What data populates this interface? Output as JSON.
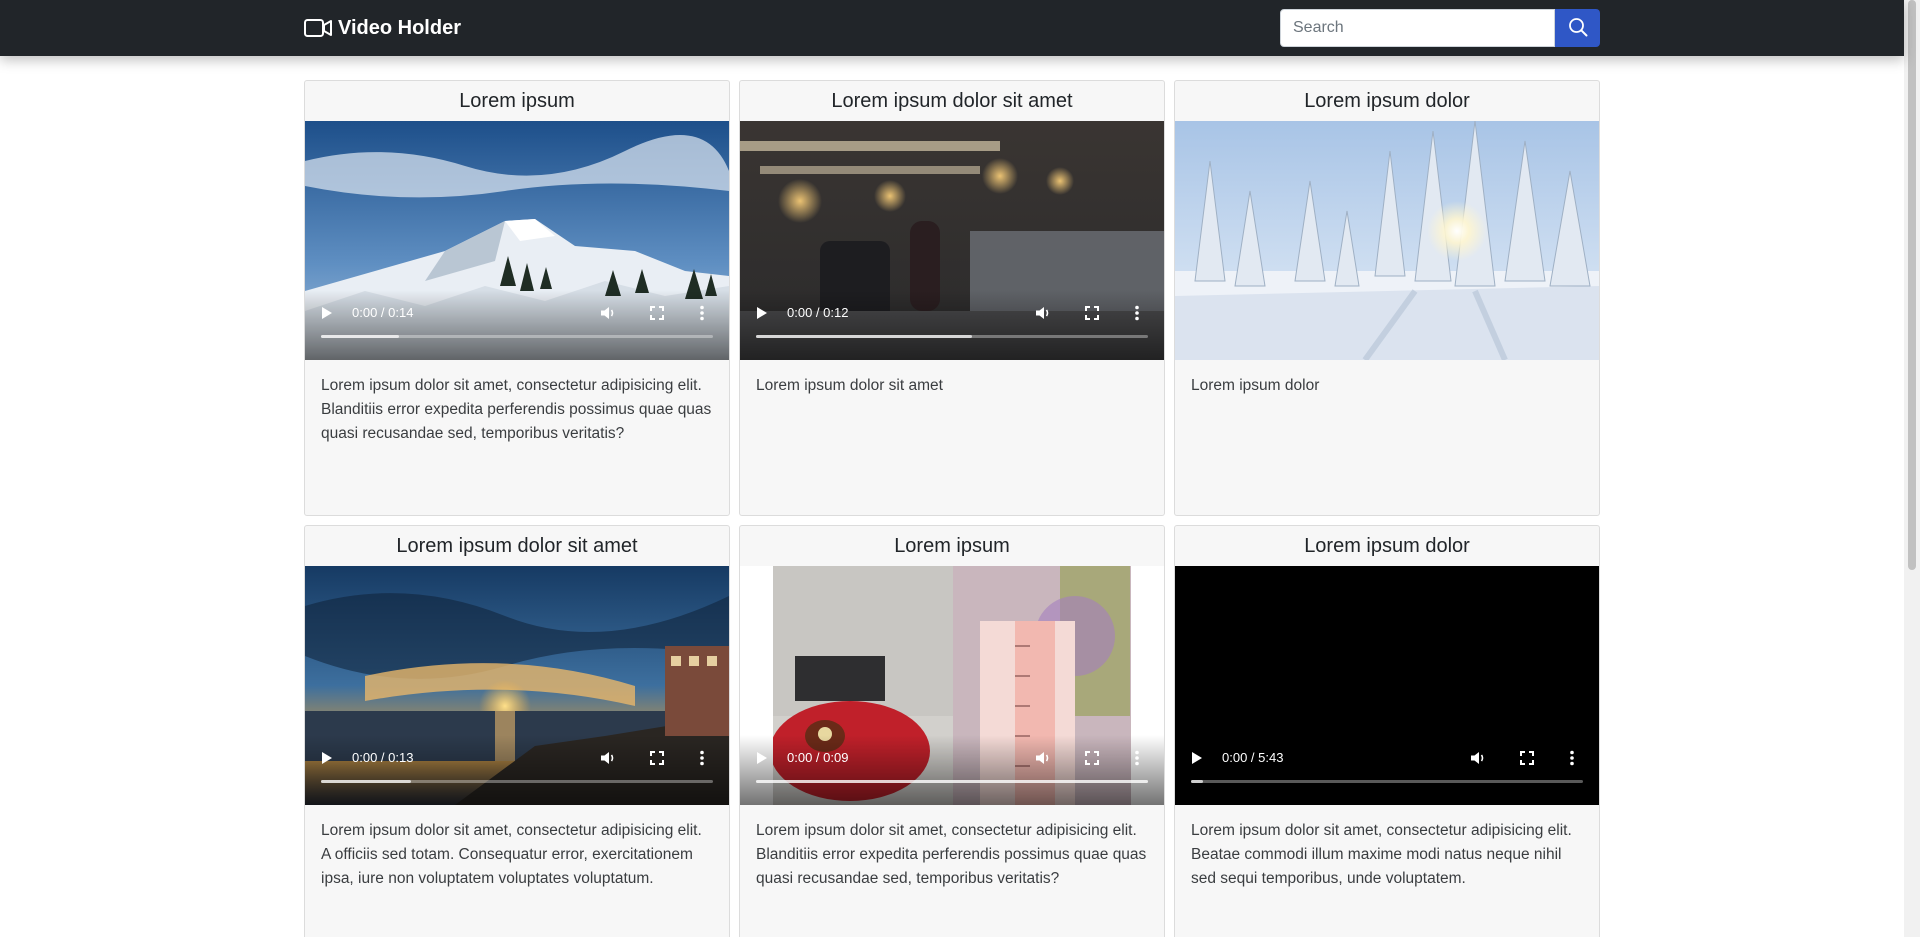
{
  "navbar": {
    "brand": "Video Holder",
    "brand_icon": "video-camera-icon",
    "search": {
      "placeholder": "Search",
      "value": "",
      "button_icon": "search-icon"
    }
  },
  "colors": {
    "navbar_bg": "#212529",
    "search_button": "#2f57c6",
    "card_bg": "#f7f7f7"
  },
  "cards": [
    {
      "title": "Lorem ipsum",
      "time": "0:00 / 0:14",
      "progress_buffered": 0.2,
      "text": "Lorem ipsum dolor sit amet, consectetur adipisicing elit. Blanditiis error expedita perferendis possimus quae quas quasi recusandae sed, temporibus veritatis?",
      "show_controls": true
    },
    {
      "title": "Lorem ipsum dolor sit amet",
      "time": "0:00 / 0:12",
      "progress_buffered": 0.55,
      "text": "Lorem ipsum dolor sit amet",
      "show_controls": true
    },
    {
      "title": "Lorem ipsum dolor",
      "time": "",
      "progress_buffered": 0,
      "text": "Lorem ipsum dolor",
      "show_controls": false
    },
    {
      "title": "Lorem ipsum dolor sit amet",
      "time": "0:00 / 0:13",
      "progress_buffered": 0.23,
      "text": "Lorem ipsum dolor sit amet, consectetur adipisicing elit. A officiis sed totam. Consequatur error, exercitationem ipsa, iure non voluptatem voluptates voluptatum.",
      "show_controls": true
    },
    {
      "title": "Lorem ipsum",
      "time": "0:00 / 0:09",
      "progress_buffered": 1.0,
      "text": "Lorem ipsum dolor sit amet, consectetur adipisicing elit. Blanditiis error expedita perferendis possimus quae quas quasi recusandae sed, temporibus veritatis?",
      "show_controls": true
    },
    {
      "title": "Lorem ipsum dolor",
      "time": "0:00 / 5:43",
      "progress_buffered": 0.03,
      "text": "Lorem ipsum dolor sit amet, consectetur adipisicing elit. Beatae commodi illum maxime modi natus neque nihil sed sequi temporibus, unde voluptatem.",
      "show_controls": true
    }
  ]
}
